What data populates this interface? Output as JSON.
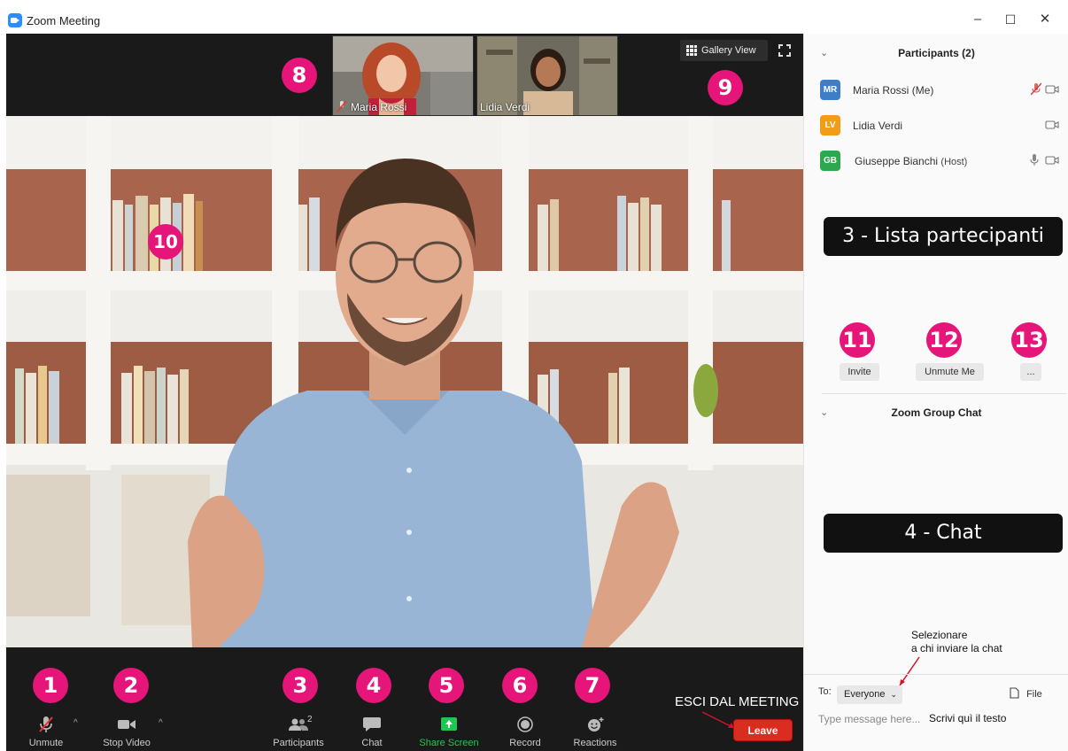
{
  "window": {
    "title": "Zoom Meeting",
    "controls": {
      "minimize": "–",
      "maximize": "☐",
      "close": "✕"
    }
  },
  "thumbnails": [
    {
      "name": "Maria Rossi",
      "muted": true
    },
    {
      "name": "Lidia Verdi",
      "muted": false
    }
  ],
  "view": {
    "gallery_label": "Gallery View"
  },
  "toolbar": {
    "unmute": "Unmute",
    "stop_video": "Stop Video",
    "participants": "Participants",
    "participants_count": "2",
    "chat": "Chat",
    "share_screen": "Share Screen",
    "record": "Record",
    "reactions": "Reactions",
    "leave": "Leave",
    "leave_annotation": "ESCI DAL MEETING"
  },
  "badges": [
    "1",
    "2",
    "3",
    "4",
    "5",
    "6",
    "7",
    "8",
    "9",
    "10",
    "11",
    "12",
    "13"
  ],
  "participants": {
    "header": "Participants (2)",
    "list": [
      {
        "initials": "MR",
        "name": "Maria Rossi",
        "role": "(Me)",
        "color": "#3d7ec6"
      },
      {
        "initials": "LV",
        "name": "Lidia Verdi",
        "role": "",
        "color": "#f29d1a"
      },
      {
        "initials": "GB",
        "name": "Giuseppe Bianchi",
        "role": "(Host)",
        "color": "#2fa74e"
      }
    ],
    "annotation": "3 - Lista partecipanti",
    "invite": "Invite",
    "unmute_me": "Unmute Me",
    "more": "..."
  },
  "chat": {
    "header": "Zoom Group Chat",
    "annotation": "4 - Chat",
    "to_label": "To:",
    "recipient": "Everyone",
    "file_label": "File",
    "placeholder": "Type message here...",
    "hint": "Scrivi quì il testo",
    "note_line1": "Selezionare",
    "note_line2": "a chi inviare la chat"
  },
  "colors": {
    "accent": "#e5157a",
    "share_green": "#23c552",
    "leave_red": "#d92d20",
    "toolbar_bg": "#1a1a1a"
  }
}
